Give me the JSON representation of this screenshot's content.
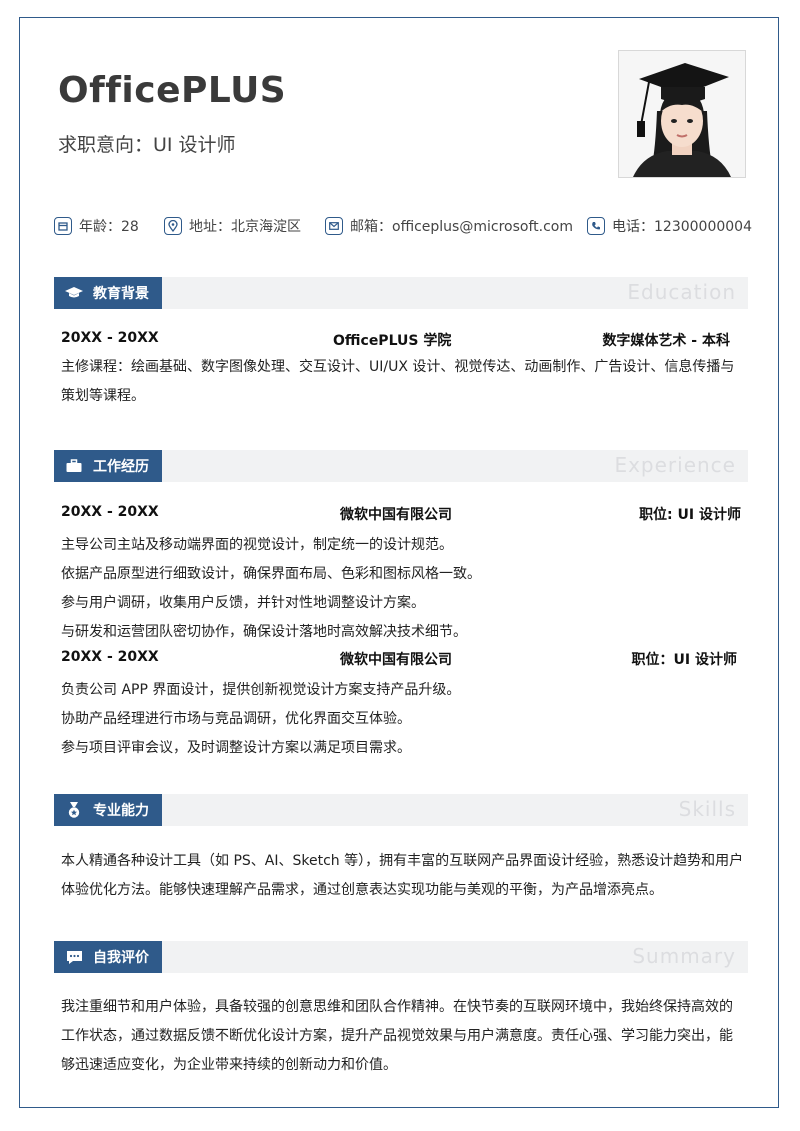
{
  "header": {
    "name": "OfficePLUS",
    "intent": "求职意向：UI 设计师"
  },
  "contact": {
    "age": "年龄：28",
    "address": "地址：北京海淀区",
    "email": "邮箱：officeplus@microsoft.com",
    "phone": "电话：12300000004",
    "icons": [
      "calendar-icon",
      "location-icon",
      "mail-icon",
      "phone-icon"
    ]
  },
  "education": {
    "title": "教育背景",
    "en": "Education",
    "period": "20XX - 20XX",
    "school": "OfficePLUS 学院",
    "major": "数字媒体艺术 - 本科",
    "desc": "主修课程：绘画基础、数字图像处理、交互设计、UI/UX 设计、视觉传达、动画制作、广告设计、信息传播与策划等课程。"
  },
  "experience": {
    "title": "工作经历",
    "en": "Experience",
    "jobs": [
      {
        "period": "20XX - 20XX",
        "company": "微软中国有限公司",
        "position": "职位: UI 设计师",
        "items": [
          "主导公司主站及移动端界面的视觉设计，制定统一的设计规范。",
          "依据产品原型进行细致设计，确保界面布局、色彩和图标风格一致。",
          "参与用户调研，收集用户反馈，并针对性地调整设计方案。",
          "与研发和运营团队密切协作，确保设计落地时高效解决技术细节。"
        ]
      },
      {
        "period": "20XX - 20XX",
        "company": "微软中国有限公司",
        "position": "职位：UI 设计师",
        "items": [
          "负责公司 APP 界面设计，提供创新视觉设计方案支持产品升级。",
          "协助产品经理进行市场与竞品调研，优化界面交互体验。",
          "参与项目评审会议，及时调整设计方案以满足项目需求。"
        ]
      }
    ]
  },
  "skills": {
    "title": "专业能力",
    "en": "Skills",
    "text": "本人精通各种设计工具（如 PS、AI、Sketch 等），拥有丰富的互联网产品界面设计经验，熟悉设计趋势和用户体验优化方法。能够快速理解产品需求，通过创意表达实现功能与美观的平衡，为产品增添亮点。"
  },
  "summary": {
    "title": "自我评价",
    "en": "Summary",
    "text": "我注重细节和用户体验，具备较强的创意思维和团队合作精神。在快节奏的互联网环境中，我始终保持高效的工作状态，通过数据反馈不断优化设计方案，提升产品视觉效果与用户满意度。责任心强、学习能力突出，能够迅速适应变化，为企业带来持续的创新动力和价值。"
  },
  "colors": {
    "accent": "#2f5a8a",
    "bar": "#f1f2f3"
  }
}
